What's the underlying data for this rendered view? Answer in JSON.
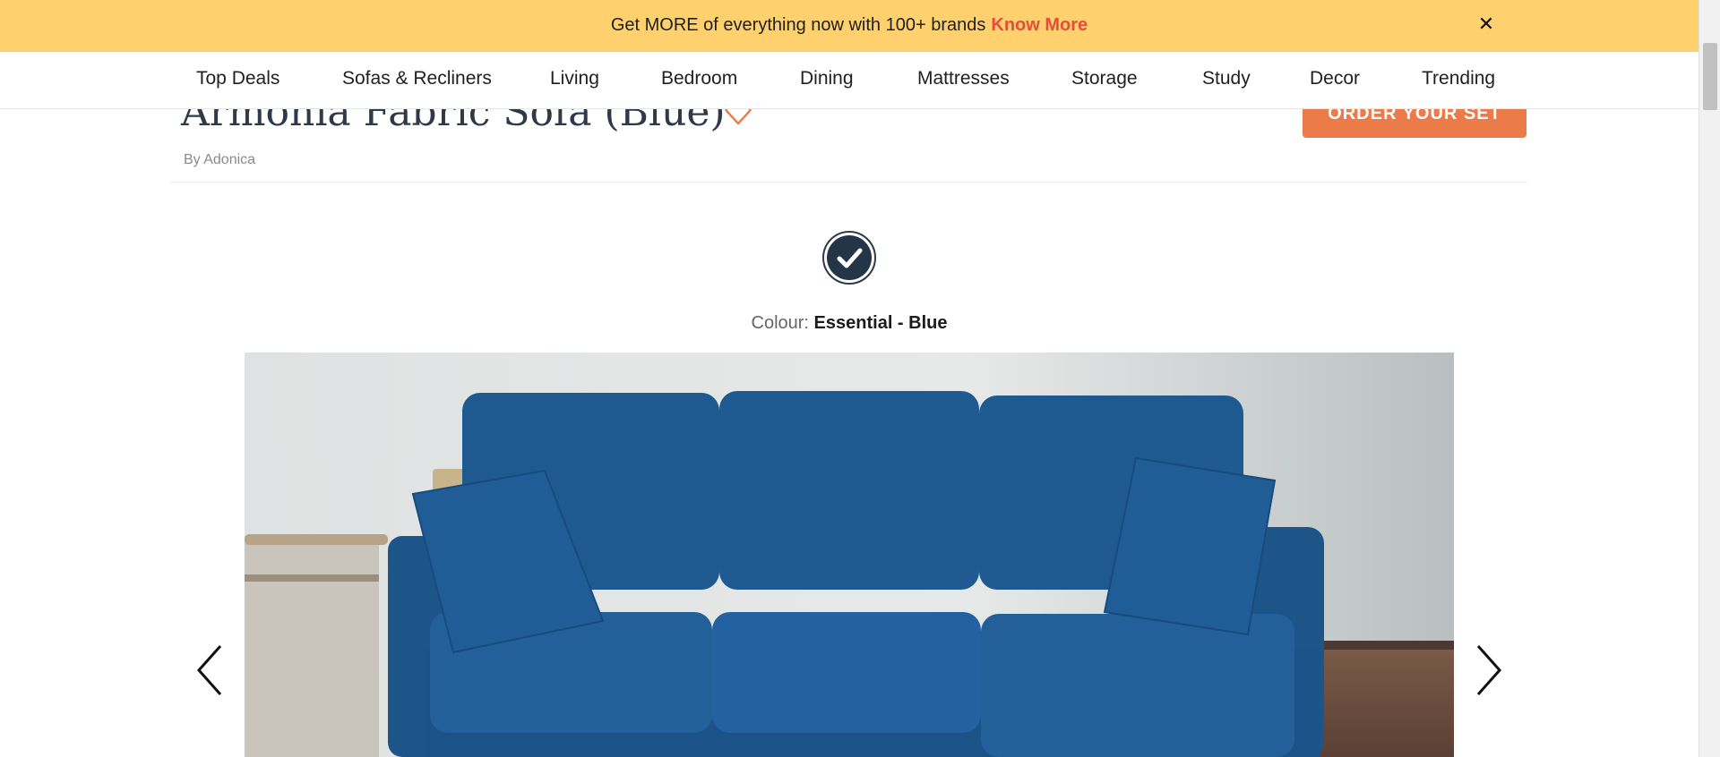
{
  "promo": {
    "text": "Get MORE of everything now with 100+ brands",
    "link": "Know More",
    "close": "✕"
  },
  "nav": {
    "items": [
      "Top Deals",
      "Sofas & Recliners",
      "Living",
      "Bedroom",
      "Dining",
      "Mattresses",
      "Storage",
      "Study",
      "Decor",
      "Trending"
    ]
  },
  "product": {
    "title": "Armonia Fabric Sofa (Blue)",
    "byline": "By Adonica",
    "order_label": "ORDER YOUR SET"
  },
  "colour": {
    "label": "Colour:",
    "value": "Essential - Blue"
  },
  "icons": {
    "wishlist": "heart-outline-icon",
    "swatch": "checkmark-icon",
    "prev": "chevron-left-icon",
    "next": "chevron-right-icon"
  },
  "colors": {
    "banner": "#fed06e",
    "accent": "#ec7b4a",
    "link": "#e84c3d",
    "sofa": "#1f5a92"
  }
}
